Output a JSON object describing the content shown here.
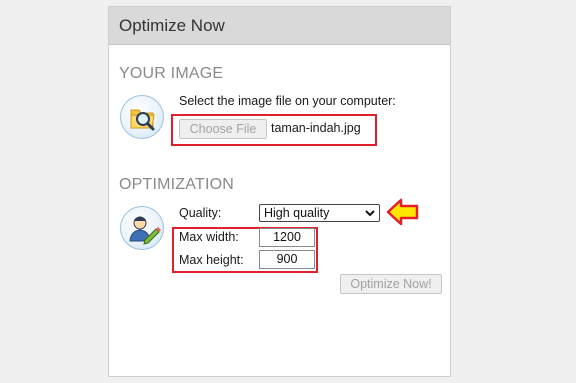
{
  "header": {
    "title": "Optimize Now"
  },
  "your_image": {
    "heading": "YOUR IMAGE",
    "icon": "folder-search-icon",
    "instruction": "Select the image file on your computer:",
    "choose_file_label": "Choose File",
    "file_name": "taman-indah.jpg"
  },
  "optimization": {
    "heading": "OPTIMIZATION",
    "icon": "user-edit-icon",
    "quality_label": "Quality:",
    "quality_value": "High quality",
    "max_width_label": "Max width:",
    "max_width_value": "1200",
    "max_height_label": "Max height:",
    "max_height_value": "900",
    "submit_label": "Optimize Now!"
  },
  "colors": {
    "highlight_red": "#e0202a",
    "arrow_yellow": "#ffe600",
    "header_gray": "#d9d9d9",
    "heading_gray": "#8a8a8a"
  }
}
